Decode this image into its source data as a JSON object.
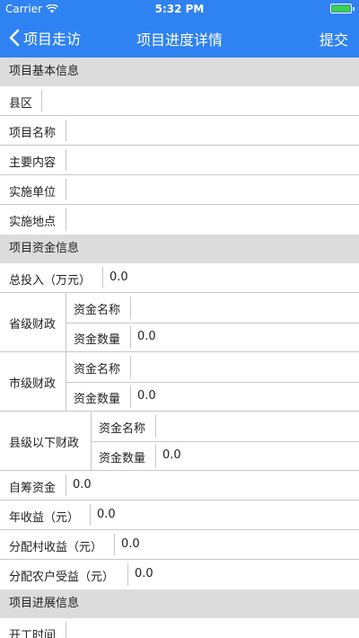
{
  "status": {
    "carrier": "Carrier",
    "time": "5:32 PM"
  },
  "nav": {
    "back_label": "项目走访",
    "title": "项目进度详情",
    "submit_label": "提交"
  },
  "basic": {
    "header": "项目基本信息",
    "fields": [
      {
        "label": "县区",
        "value": ""
      },
      {
        "label": "项目名称",
        "value": ""
      },
      {
        "label": "主要内容",
        "value": ""
      },
      {
        "label": "实施单位",
        "value": ""
      },
      {
        "label": "实施地点",
        "value": ""
      }
    ]
  },
  "funds": {
    "header": "项目资金信息",
    "total": {
      "label": "总投入（万元）",
      "value": "0.0"
    },
    "province": {
      "label": "省级财政",
      "name_label": "资金名称",
      "name_value": "",
      "amount_label": "资金数量",
      "amount_value": "0.0"
    },
    "city": {
      "label": "市级财政",
      "name_label": "资金名称",
      "name_value": "",
      "amount_label": "资金数量",
      "amount_value": "0.0"
    },
    "county": {
      "label": "县级以下财政",
      "name_label": "资金名称",
      "name_value": "",
      "amount_label": "资金数量",
      "amount_value": "0.0"
    },
    "self_raised": {
      "label": "自筹资金",
      "value": "0.0"
    },
    "annual_income": {
      "label": "年收益（元）",
      "value": "0.0"
    },
    "village_income": {
      "label": "分配村收益（元）",
      "value": "0.0"
    },
    "household_income": {
      "label": "分配农户受益（元）",
      "value": "0.0"
    }
  },
  "progress": {
    "header": "项目进展信息",
    "start_time": {
      "label": "开工时间",
      "value": ""
    }
  }
}
